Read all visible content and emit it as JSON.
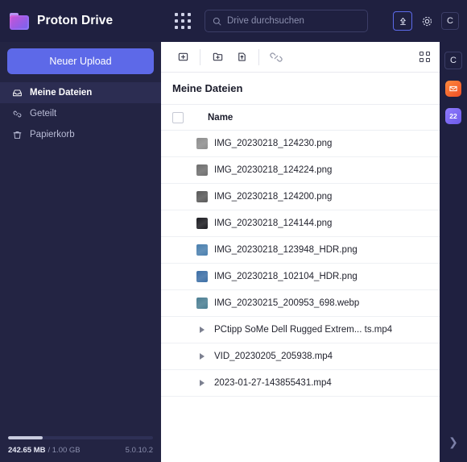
{
  "header": {
    "brand": "Proton Drive",
    "logo_icon": "proton-drive-folder-logo",
    "apps_icon": "apps-grid-icon",
    "search": {
      "placeholder": "Drive durchsuchen",
      "value": "",
      "icon": "search-icon"
    },
    "upload_icon": "upload-arrow-icon",
    "settings_icon": "gear-icon",
    "avatar_label": "C"
  },
  "sidebar": {
    "upload_button": "Neuer Upload",
    "items": [
      {
        "label": "Meine Dateien",
        "icon": "inbox-tray-icon",
        "active": true
      },
      {
        "label": "Geteilt",
        "icon": "link-icon",
        "active": false
      },
      {
        "label": "Papierkorb",
        "icon": "trash-icon",
        "active": false
      }
    ],
    "storage": {
      "used": "242.65 MB",
      "separator": "/",
      "total": "1.00 GB",
      "percent": 24,
      "version": "5.0.10.2"
    }
  },
  "toolbar": {
    "buttons": [
      {
        "name": "new-item-button",
        "icon": "box-plus-icon"
      },
      {
        "name": "new-folder-button",
        "icon": "folder-plus-icon"
      },
      {
        "name": "upload-file-button",
        "icon": "file-upload-icon"
      },
      {
        "name": "share-link-button",
        "icon": "link-icon"
      }
    ],
    "grid_view_icon": "grid-view-icon"
  },
  "main": {
    "title": "Meine Dateien",
    "columns": [
      "Name"
    ],
    "select_all_checked": false,
    "files": [
      {
        "name": "IMG_20230218_124230.png",
        "kind": "image",
        "thumb": "#8e8e8e"
      },
      {
        "name": "IMG_20230218_124224.png",
        "kind": "image",
        "thumb": "#6e6e6e"
      },
      {
        "name": "IMG_20230218_124200.png",
        "kind": "image",
        "thumb": "#5a5a5a"
      },
      {
        "name": "IMG_20230218_124144.png",
        "kind": "image",
        "thumb": "#1d1d22"
      },
      {
        "name": "IMG_20230218_123948_HDR.png",
        "kind": "image",
        "thumb": "#4a7fae"
      },
      {
        "name": "IMG_20230218_102104_HDR.png",
        "kind": "image",
        "thumb": "#3d6fa6"
      },
      {
        "name": "IMG_20230215_200953_698.webp",
        "kind": "image",
        "thumb": "#4c7f93"
      },
      {
        "name": "PCtipp SoMe Dell Rugged Extrem... ts.mp4",
        "kind": "video",
        "thumb": ""
      },
      {
        "name": "VID_20230205_205938.mp4",
        "kind": "video",
        "thumb": ""
      },
      {
        "name": "2023-01-27-143855431.mp4",
        "kind": "video",
        "thumb": ""
      }
    ]
  },
  "rail": {
    "avatar_label": "C",
    "apps": [
      {
        "name": "proton-mail-app-icon",
        "label": ""
      },
      {
        "name": "proton-calendar-app-icon",
        "label": "22"
      }
    ],
    "expand_icon": "chevron-right-icon"
  },
  "colors": {
    "header_bg": "#1f2040",
    "sidebar_bg": "#232443",
    "accent": "#5d69e8",
    "panel_bg": "#ffffff"
  }
}
